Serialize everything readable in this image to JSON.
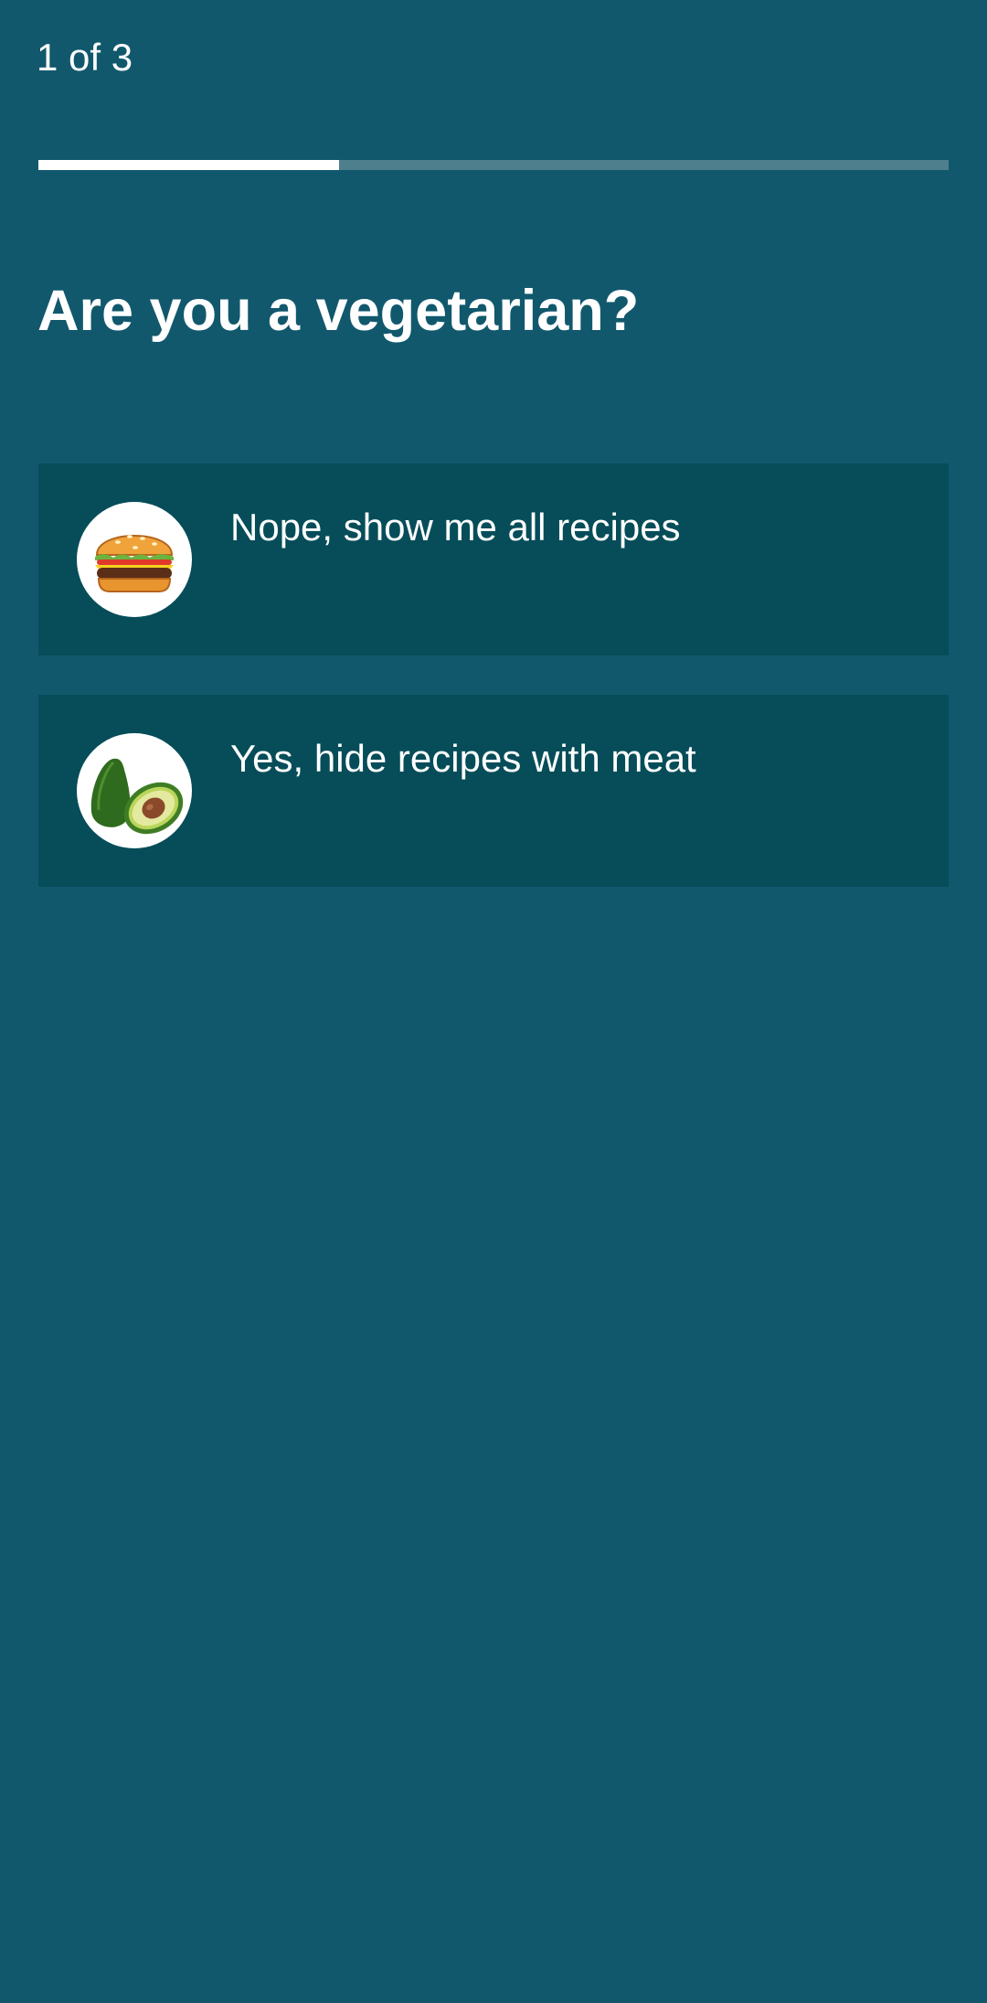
{
  "step_counter": "1 of 3",
  "progress": {
    "fraction": 0.33,
    "fill_color": "#ffffff",
    "track_color": "#4e7f8d"
  },
  "question": "Are you a vegetarian?",
  "options": [
    {
      "label": "Nope, show me all recipes",
      "icon": "burger-icon"
    },
    {
      "label": "Yes, hide recipes with meat",
      "icon": "avocado-icon"
    }
  ],
  "colors": {
    "background": "#11586d",
    "card": "#064d59",
    "text": "#ffffff"
  }
}
